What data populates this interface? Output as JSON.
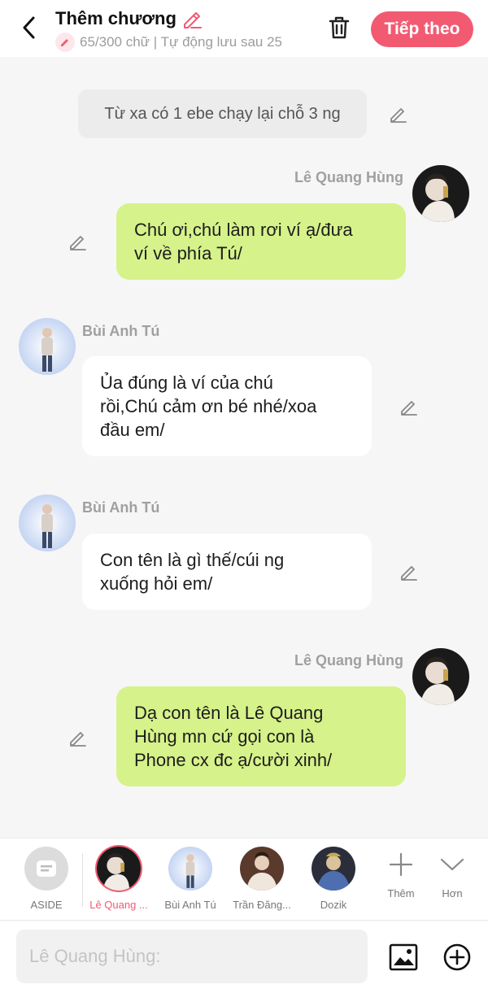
{
  "header": {
    "title": "Thêm chương",
    "status": "65/300 chữ | Tự động lưu sau 25",
    "next_label": "Tiếp theo"
  },
  "messages": [
    {
      "type": "aside",
      "text": "Từ xa có 1 ebe chạy lại chỗ 3 ng"
    },
    {
      "type": "right",
      "name": "Lê Quang Hùng",
      "line1": "Chú ơi,chú làm rơi ví ạ/đưa",
      "line2": "ví về phía Tú/"
    },
    {
      "type": "left",
      "name": "Bùi Anh Tú",
      "line1": "Ủa đúng là ví của chú",
      "line2": "rồi,Chú cảm ơn bé nhé/xoa",
      "line3": "đầu em/"
    },
    {
      "type": "left",
      "name": "Bùi Anh Tú",
      "line1": "Con tên là gì thế/cúi ng",
      "line2": "xuống hỏi em/"
    },
    {
      "type": "right",
      "name": "Lê Quang Hùng",
      "line1": "Dạ con tên là Lê Quang",
      "line2": "Hùng mn cứ gọi con là",
      "line3": "Phone cx đc ạ/cười xinh/"
    }
  ],
  "characters": [
    {
      "label": "ASIDE"
    },
    {
      "label": "Lê Quang ..."
    },
    {
      "label": "Bùi Anh Tú"
    },
    {
      "label": "Trần Đăng..."
    },
    {
      "label": "Dozik"
    }
  ],
  "actions": {
    "more_label": "Thêm",
    "collapse_label": "Hơn"
  },
  "input": {
    "placeholder": "Lê Quang Hùng:"
  },
  "colors": {
    "accent": "#f25a72",
    "green_bubble": "#d6f28a",
    "background": "#f6f6f6"
  }
}
